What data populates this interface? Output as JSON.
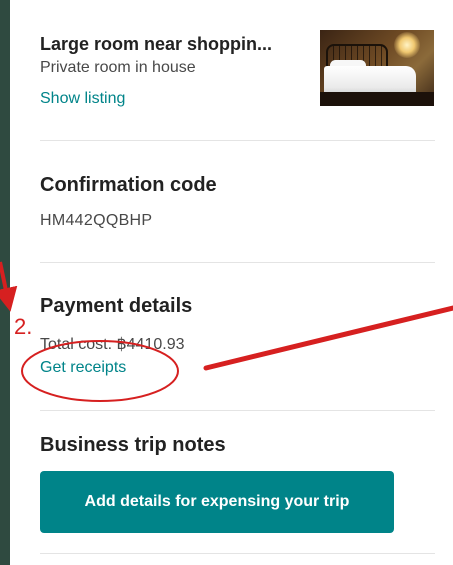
{
  "listing": {
    "title": "Large room near shoppin...",
    "subtitle": "Private room in house",
    "show_listing_label": "Show listing"
  },
  "confirmation": {
    "heading": "Confirmation code",
    "code": "HM442QQBHP"
  },
  "payment": {
    "heading": "Payment details",
    "total_cost": "Total cost: ฿4410.93",
    "get_receipts_label": "Get receipts"
  },
  "business_trip": {
    "heading": "Business trip notes",
    "button_label": "Add details for expensing your trip"
  },
  "annotation": {
    "step_label": "2.",
    "color": "#d62020"
  },
  "colors": {
    "accent": "#008489",
    "frame_background": "#2f4a40"
  }
}
